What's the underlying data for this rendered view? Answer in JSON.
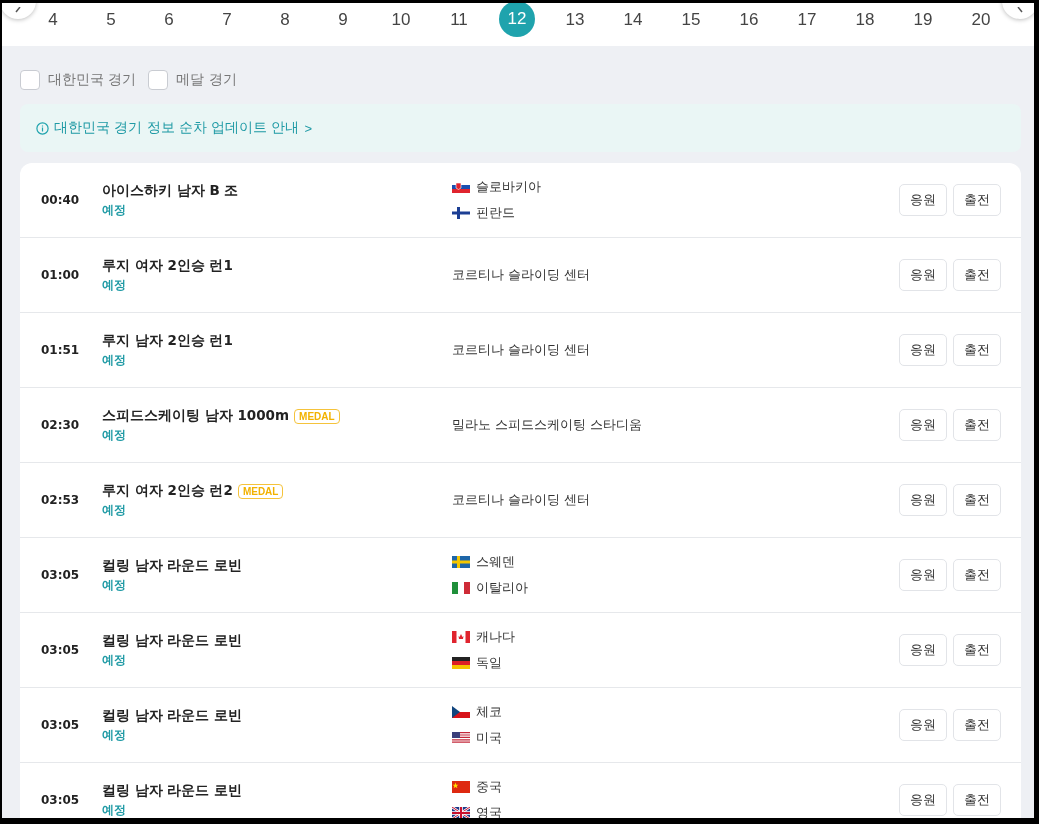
{
  "dates": [
    {
      "label": "4",
      "selected": false
    },
    {
      "label": "5",
      "selected": false
    },
    {
      "label": "6",
      "selected": false
    },
    {
      "label": "7",
      "selected": false
    },
    {
      "label": "8",
      "selected": false
    },
    {
      "label": "9",
      "selected": false
    },
    {
      "label": "10",
      "selected": false
    },
    {
      "label": "11",
      "selected": false
    },
    {
      "label": "12",
      "selected": true
    },
    {
      "label": "13",
      "selected": false
    },
    {
      "label": "14",
      "selected": false
    },
    {
      "label": "15",
      "selected": false
    },
    {
      "label": "16",
      "selected": false
    },
    {
      "label": "17",
      "selected": false
    },
    {
      "label": "18",
      "selected": false
    },
    {
      "label": "19",
      "selected": false
    },
    {
      "label": "20",
      "selected": false
    }
  ],
  "filters": [
    {
      "label": "대한민국 경기",
      "checked": false
    },
    {
      "label": "메달 경기",
      "checked": false
    }
  ],
  "notice": {
    "text": "대한민국 경기 정보 순차 업데이트 안내",
    "arrow": ">"
  },
  "events": [
    {
      "time": "00:40",
      "title": "아이스하키 남자 B 조",
      "status": "예정",
      "teams": [
        {
          "name": "슬로바키아",
          "kind": "sk"
        },
        {
          "name": "핀란드",
          "kind": "fi"
        }
      ],
      "buttons": [
        "응원",
        "출전"
      ]
    },
    {
      "time": "01:00",
      "title": "루지 여자 2인승 런1",
      "status": "예정",
      "venue": "코르티나 슬라이딩 센터",
      "buttons": [
        "응원",
        "출전"
      ]
    },
    {
      "time": "01:51",
      "title": "루지 남자 2인승 런1",
      "status": "예정",
      "venue": "코르티나 슬라이딩 센터",
      "buttons": [
        "응원",
        "출전"
      ]
    },
    {
      "time": "02:30",
      "title": "스피드스케이팅 남자 1000m",
      "badge": "MEDAL",
      "status": "예정",
      "venue": "밀라노 스피드스케이팅 스타디움",
      "buttons": [
        "응원",
        "출전"
      ]
    },
    {
      "time": "02:53",
      "title": "루지 여자 2인승 런2",
      "badge": "MEDAL",
      "status": "예정",
      "venue": "코르티나 슬라이딩 센터",
      "buttons": [
        "응원",
        "출전"
      ]
    },
    {
      "time": "03:05",
      "title": "컬링 남자 라운드 로빈",
      "status": "예정",
      "teams": [
        {
          "name": "스웨덴",
          "kind": "se"
        },
        {
          "name": "이탈리아",
          "kind": "it"
        }
      ],
      "buttons": [
        "응원",
        "출전"
      ]
    },
    {
      "time": "03:05",
      "title": "컬링 남자 라운드 로빈",
      "status": "예정",
      "teams": [
        {
          "name": "캐나다",
          "kind": "ca"
        },
        {
          "name": "독일",
          "kind": "de"
        }
      ],
      "buttons": [
        "응원",
        "출전"
      ]
    },
    {
      "time": "03:05",
      "title": "컬링 남자 라운드 로빈",
      "status": "예정",
      "teams": [
        {
          "name": "체코",
          "kind": "cz"
        },
        {
          "name": "미국",
          "kind": "us"
        }
      ],
      "buttons": [
        "응원",
        "출전"
      ]
    },
    {
      "time": "03:05",
      "title": "컬링 남자 라운드 로빈",
      "status": "예정",
      "teams": [
        {
          "name": "중국",
          "kind": "cn"
        },
        {
          "name": "영국",
          "kind": "gb"
        }
      ],
      "buttons": [
        "응원",
        "출전"
      ]
    }
  ]
}
